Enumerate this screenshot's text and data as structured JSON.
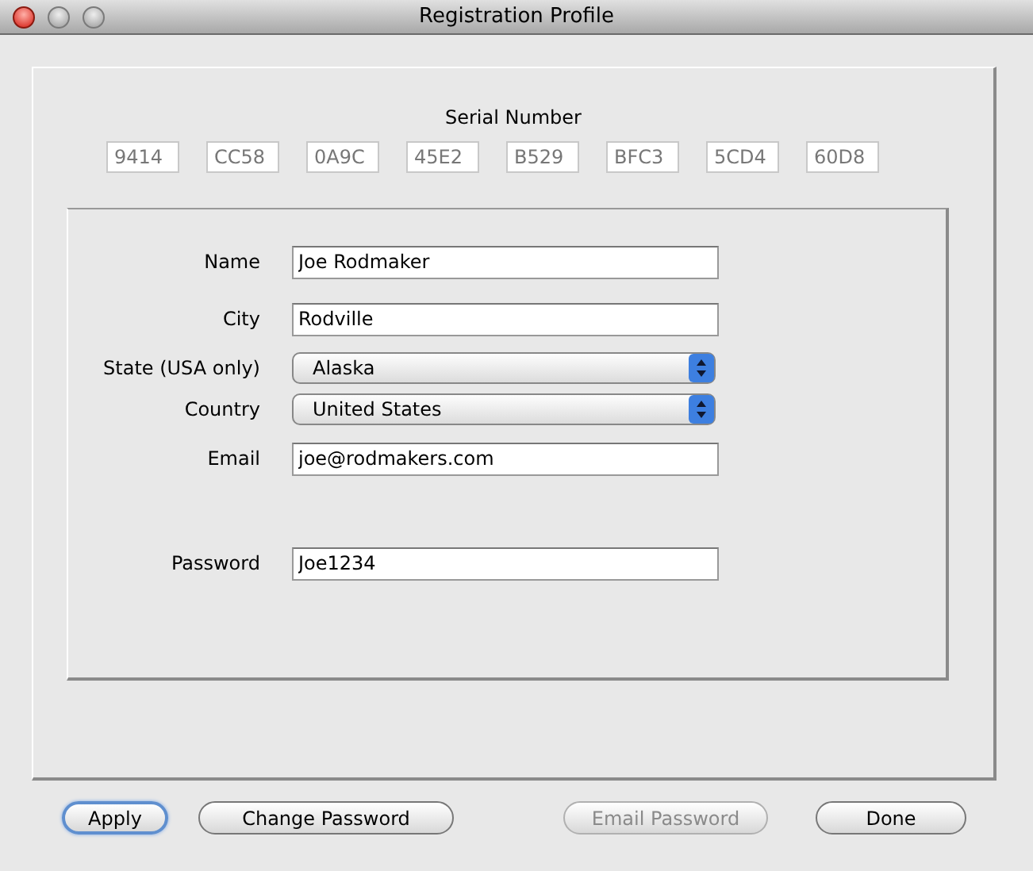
{
  "window": {
    "title": "Registration Profile"
  },
  "serial": {
    "label": "Serial Number",
    "parts": [
      "9414",
      "CC58",
      "0A9C",
      "45E2",
      "B529",
      "BFC3",
      "5CD4",
      "60D8"
    ]
  },
  "fields": [
    {
      "label": "Name",
      "kind": "text",
      "value": "Joe Rodmaker"
    },
    {
      "label": "City",
      "kind": "text",
      "value": "Rodville"
    },
    {
      "label": "State (USA only)",
      "kind": "popup",
      "value": "Alaska"
    },
    {
      "label": "Country",
      "kind": "popup",
      "value": "United States"
    },
    {
      "label": "Email",
      "kind": "text",
      "value": "joe@rodmakers.com"
    },
    {
      "label": "Password",
      "kind": "text",
      "value": "Joe1234"
    }
  ],
  "buttons": [
    {
      "label": "Apply",
      "default": true,
      "disabled": false
    },
    {
      "label": "Change Password",
      "default": false,
      "disabled": false
    },
    {
      "label": "Email Password",
      "default": false,
      "disabled": true
    },
    {
      "label": "Done",
      "default": false,
      "disabled": false
    }
  ]
}
